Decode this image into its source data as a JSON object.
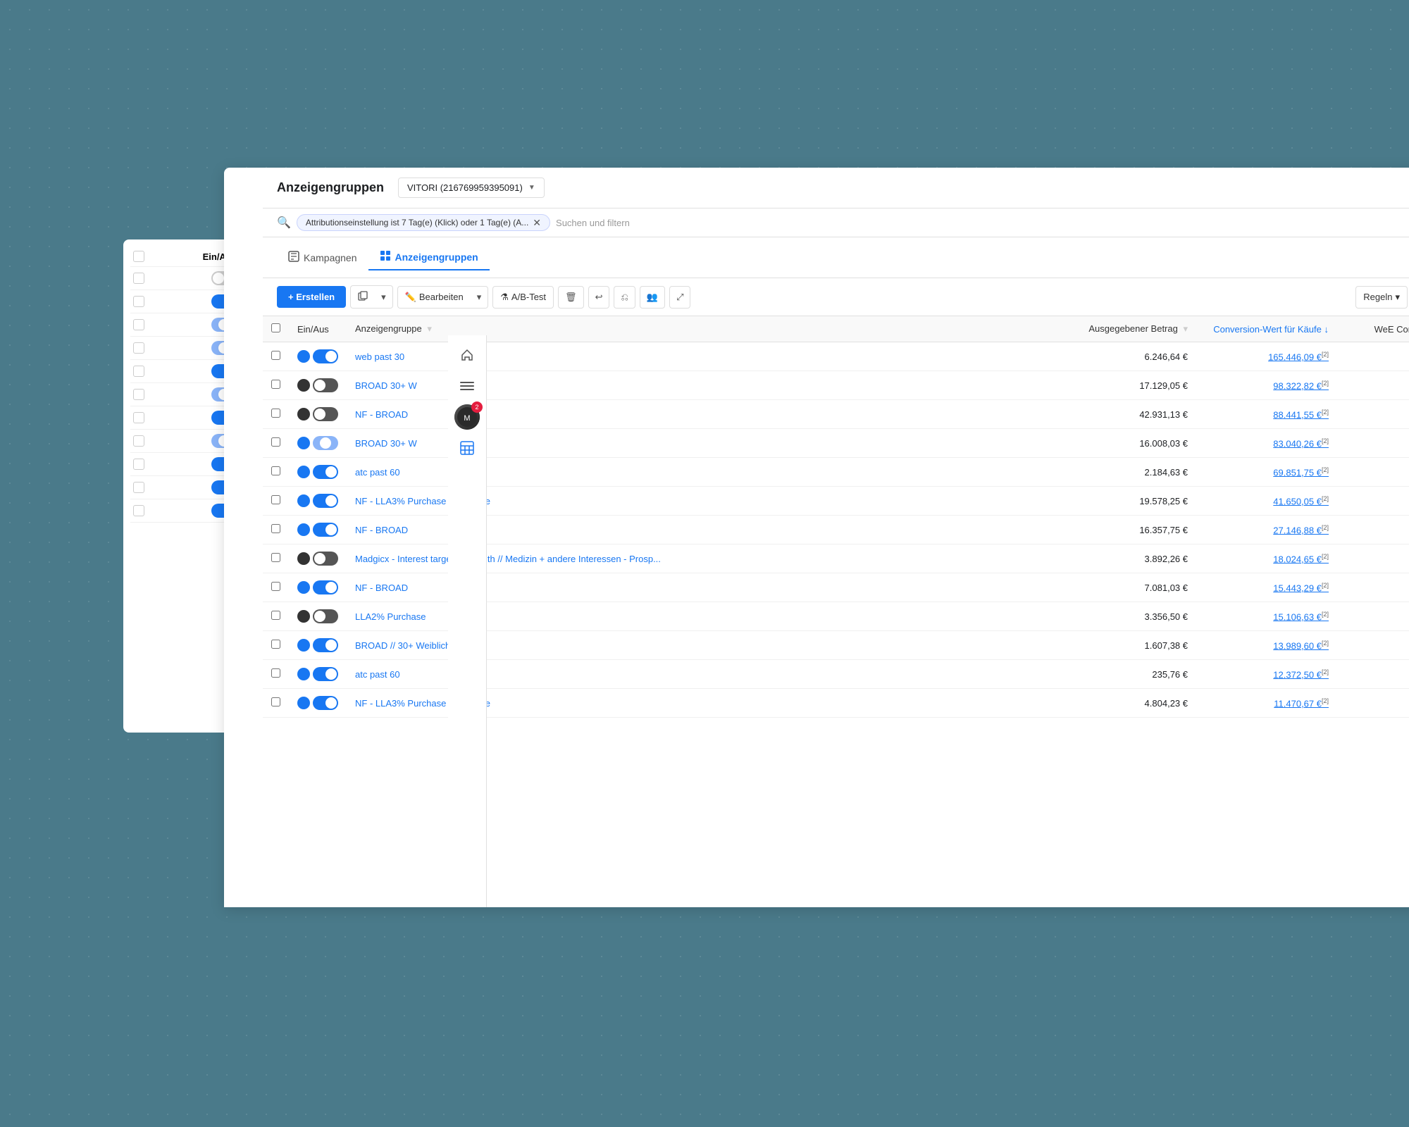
{
  "app": {
    "title": "Anzeigengruppen",
    "account_label": "VITORI (216769959395091)",
    "search_filter_text": "Attributionseinstellung ist 7 Tag(e) (Klick) oder 1 Tag(e) (A...",
    "search_placeholder": "Suchen und filtern"
  },
  "nav": {
    "campaigns_label": "Kampagnen",
    "ad_groups_label": "Anzeigengruppen"
  },
  "toolbar": {
    "create_label": "+ Erstellen",
    "edit_label": "Bearbeiten",
    "ab_test_label": "A/B-Test",
    "rules_label": "Regeln"
  },
  "table": {
    "columns": {
      "ein_aus": "Ein/Aus",
      "anzeigengruppe": "Anzeigengruppe",
      "ausgegebener_betrag": "Ausgegebener Betrag",
      "conversion_wert": "Conversion-Wert für Käufe",
      "web_con": "WeE Con"
    },
    "rows": [
      {
        "name": "web past 30",
        "toggle_state": "on",
        "betrag": "6.246,64 €",
        "conversion": "165.446,09 €",
        "conversion_note": "[2]",
        "web_con": ""
      },
      {
        "name": "BROAD 30+ W",
        "toggle_state": "off",
        "betrag": "17.129,05 €",
        "conversion": "98.322,82 €",
        "conversion_note": "[2]",
        "web_con": ""
      },
      {
        "name": "NF - BROAD",
        "toggle_state": "off",
        "betrag": "42.931,13 €",
        "conversion": "88.441,55 €",
        "conversion_note": "[2]",
        "web_con": ""
      },
      {
        "name": "BROAD 30+ W",
        "toggle_state": "partial",
        "betrag": "16.008,03 €",
        "conversion": "83.040,26 €",
        "conversion_note": "[2]",
        "web_con": ""
      },
      {
        "name": "atc past 60",
        "toggle_state": "on",
        "betrag": "2.184,63 €",
        "conversion": "69.851,75 €",
        "conversion_note": "[2]",
        "web_con": ""
      },
      {
        "name": "NF - LLA3% Purchase with Value",
        "toggle_state": "on",
        "betrag": "19.578,25 €",
        "conversion": "41.650,05 €",
        "conversion_note": "[2]",
        "web_con": ""
      },
      {
        "name": "NF - BROAD",
        "toggle_state": "on",
        "betrag": "16.357,75 €",
        "conversion": "27.146,88 €",
        "conversion_note": "[2]",
        "web_con": ""
      },
      {
        "name": "Madgicx - Interest targeting Health // Medizin + andere Interessen - Prosp...",
        "toggle_state": "off",
        "betrag": "3.892,26 €",
        "conversion": "18.024,65 €",
        "conversion_note": "[2]",
        "web_con": ""
      },
      {
        "name": "NF - BROAD",
        "toggle_state": "on",
        "betrag": "7.081,03 €",
        "conversion": "15.443,29 €",
        "conversion_note": "[2]",
        "web_con": ""
      },
      {
        "name": "LLA2% Purchase",
        "toggle_state": "off",
        "betrag": "3.356,50 €",
        "conversion": "15.106,63 €",
        "conversion_note": "[2]",
        "web_con": ""
      },
      {
        "name": "BROAD // 30+ Weiblich",
        "toggle_state": "on",
        "betrag": "1.607,38 €",
        "conversion": "13.989,60 €",
        "conversion_note": "[2]",
        "web_con": ""
      },
      {
        "name": "atc past 60",
        "toggle_state": "on",
        "betrag": "235,76 €",
        "conversion": "12.372,50 €",
        "conversion_note": "[2]",
        "web_con": ""
      },
      {
        "name": "NF - LLA3% Purchase with Value",
        "toggle_state": "on",
        "betrag": "4.804,23 €",
        "conversion": "11.470,67 €",
        "conversion_note": "[2]",
        "web_con": ""
      }
    ]
  },
  "left_panel": {
    "rows": [
      {
        "toggle": "off"
      },
      {
        "toggle": "on"
      },
      {
        "toggle": "partial"
      },
      {
        "toggle": "partial"
      },
      {
        "toggle": "on"
      },
      {
        "toggle": "partial"
      },
      {
        "toggle": "on"
      },
      {
        "toggle": "partial"
      },
      {
        "toggle": "on"
      },
      {
        "toggle": "on"
      },
      {
        "toggle": "on"
      }
    ]
  },
  "colors": {
    "blue": "#1877f2",
    "dark": "#1c1e21",
    "border": "#e0e0e0",
    "accent": "#1877f2",
    "bg_teal": "#4a7a8a"
  }
}
